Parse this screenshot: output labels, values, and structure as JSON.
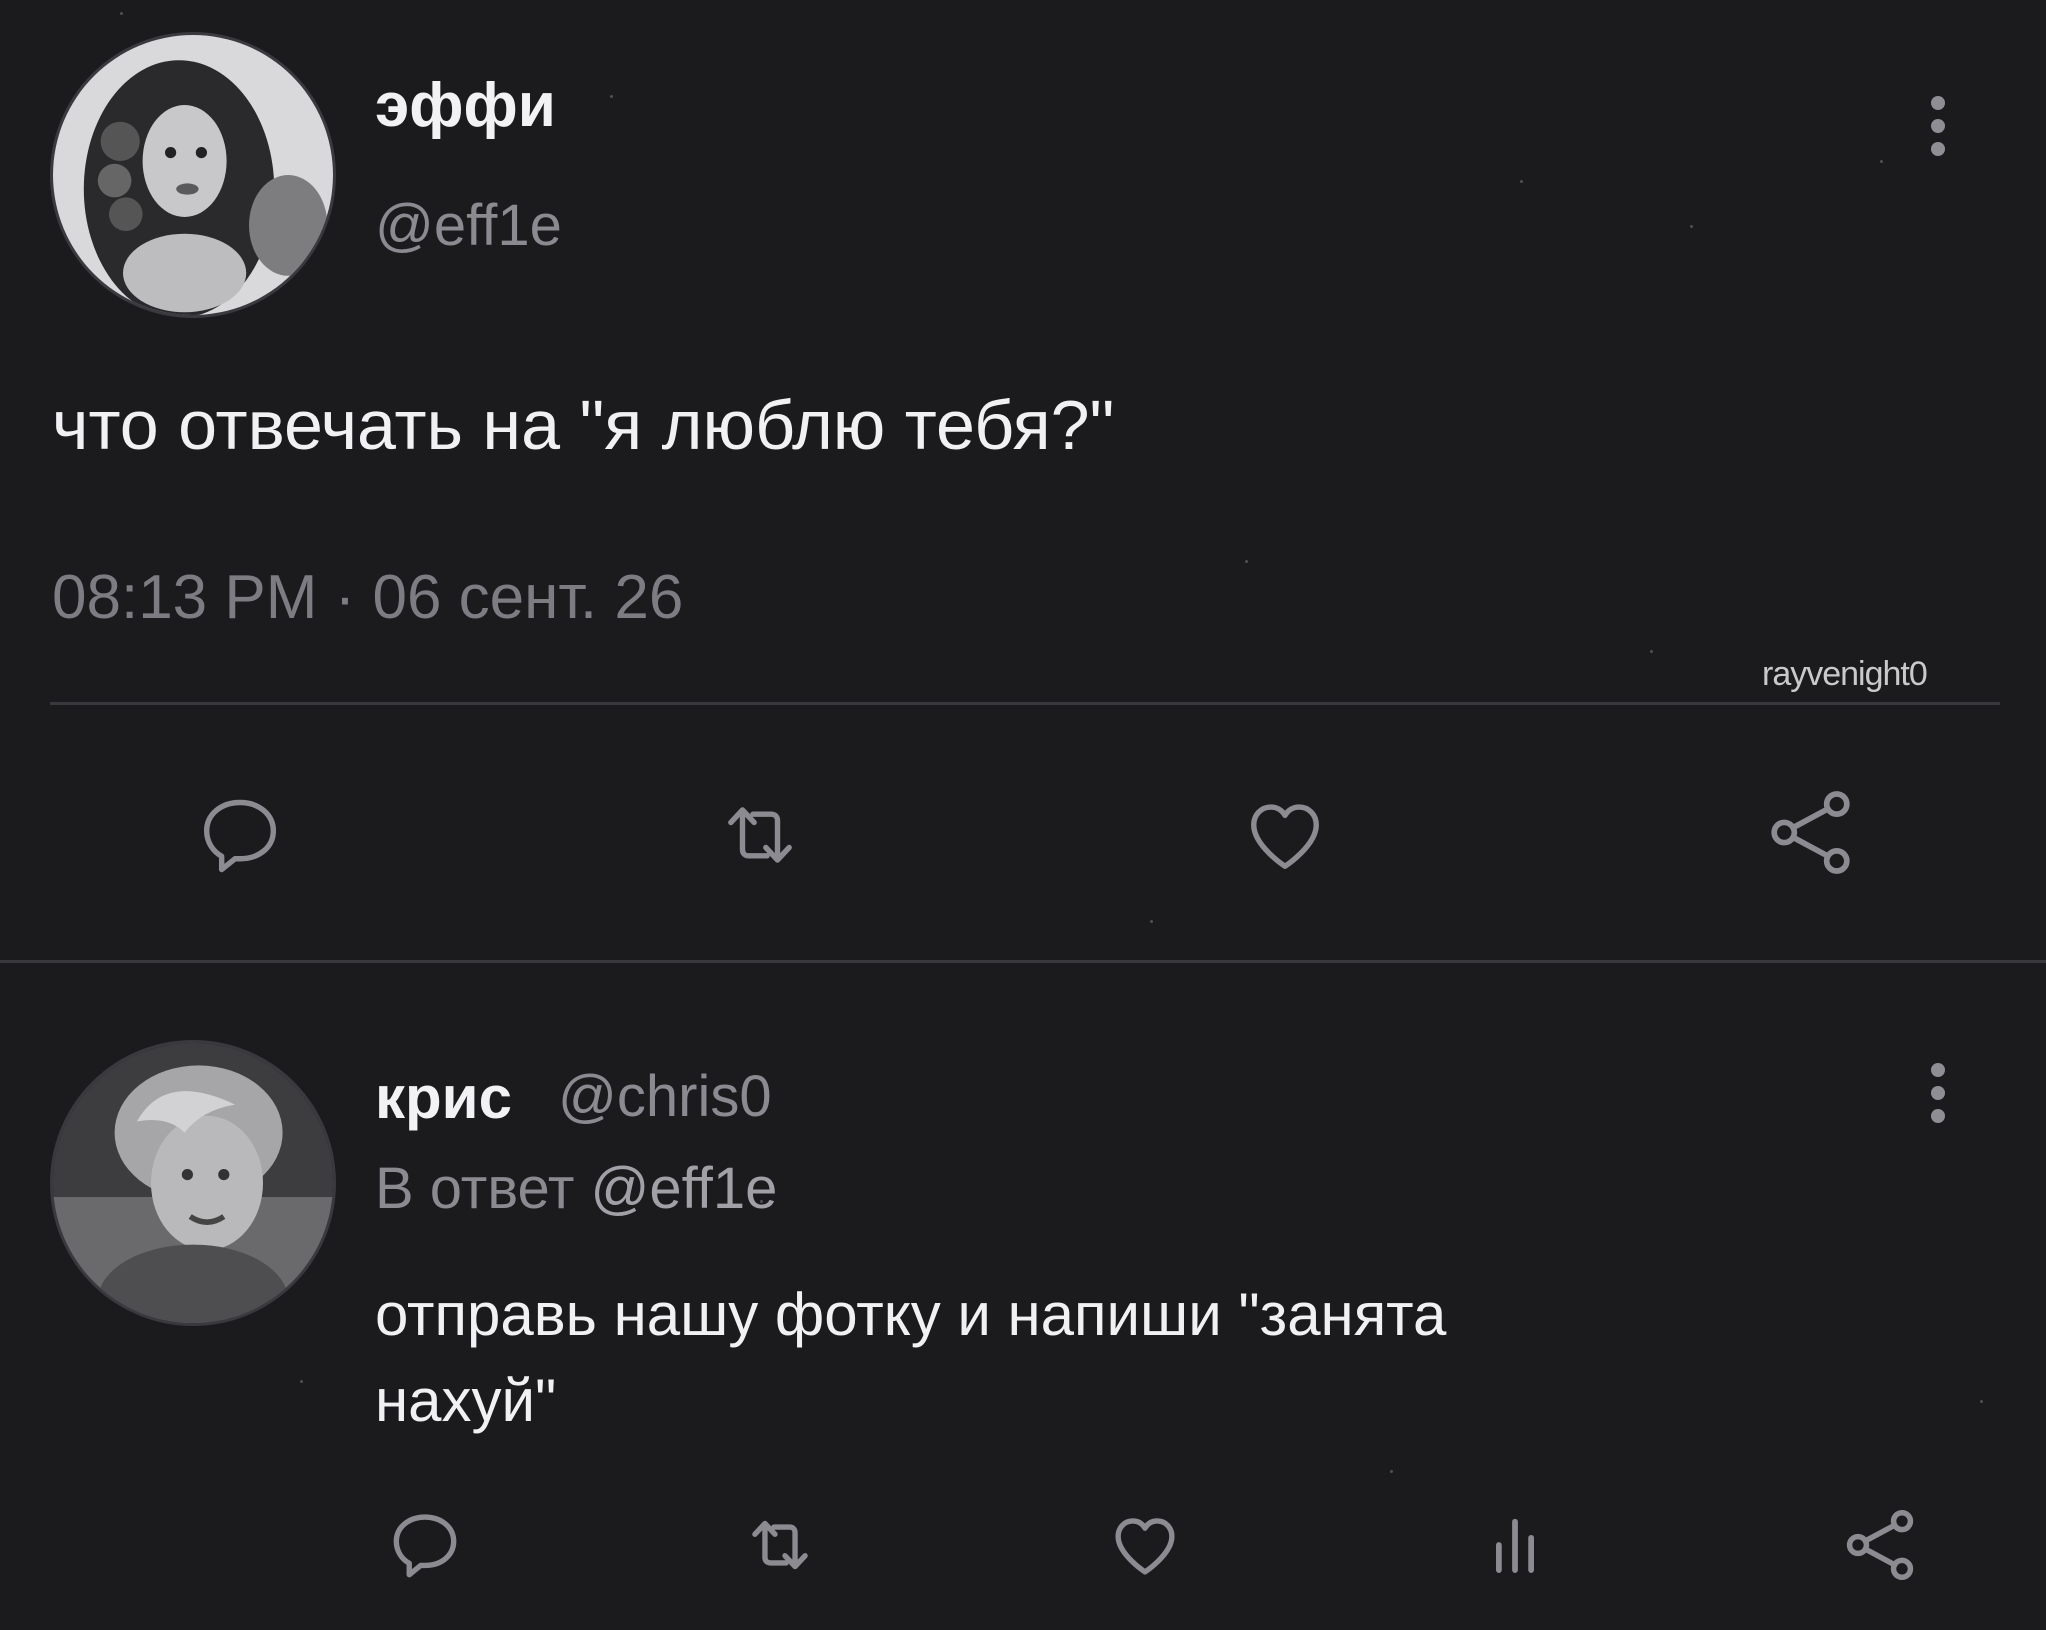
{
  "main_tweet": {
    "display_name": "эффи",
    "handle": "@eff1e",
    "text": "что отвечать на \"я люблю тебя?\"",
    "timestamp": "08:13 PM · 06 сент. 26",
    "watermark": "rayvenight0",
    "actions": [
      "reply-icon",
      "retweet-icon",
      "like-icon",
      "share-icon"
    ]
  },
  "reply_tweet": {
    "display_name": "крис",
    "handle": "@chris0",
    "reply_prefix": "В ответ",
    "reply_to": "@eff1e",
    "text_line1": "отправь нашу фотку и напиши \"занята",
    "text_line2": "нахуй\"",
    "actions": [
      "reply-icon",
      "retweet-icon",
      "like-icon",
      "analytics-icon",
      "share-icon"
    ]
  },
  "colors": {
    "background": "#1b1b1e",
    "text_primary": "#f1f1f3",
    "text_secondary": "#8a8a90",
    "link": "#9a9aa0",
    "divider": "#39393d"
  }
}
